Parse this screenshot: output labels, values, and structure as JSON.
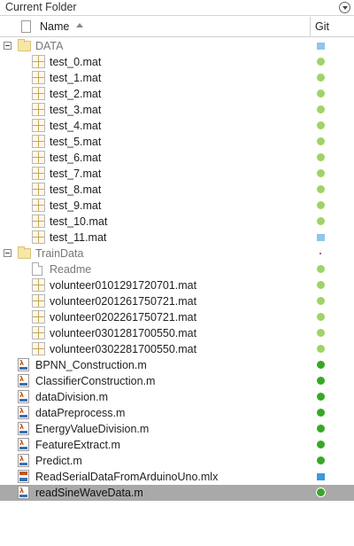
{
  "panel": {
    "title": "Current Folder"
  },
  "columns": {
    "name": "Name",
    "git": "Git"
  },
  "rows": [
    {
      "label": "DATA",
      "type": "folder",
      "indent": 0,
      "expandable": true,
      "git": "square"
    },
    {
      "label": "test_0.mat",
      "type": "mat",
      "indent": 1,
      "git": "unmodified"
    },
    {
      "label": "test_1.mat",
      "type": "mat",
      "indent": 1,
      "git": "unmodified"
    },
    {
      "label": "test_2.mat",
      "type": "mat",
      "indent": 1,
      "git": "unmodified"
    },
    {
      "label": "test_3.mat",
      "type": "mat",
      "indent": 1,
      "git": "unmodified"
    },
    {
      "label": "test_4.mat",
      "type": "mat",
      "indent": 1,
      "git": "unmodified"
    },
    {
      "label": "test_5.mat",
      "type": "mat",
      "indent": 1,
      "git": "unmodified"
    },
    {
      "label": "test_6.mat",
      "type": "mat",
      "indent": 1,
      "git": "unmodified"
    },
    {
      "label": "test_7.mat",
      "type": "mat",
      "indent": 1,
      "git": "unmodified"
    },
    {
      "label": "test_8.mat",
      "type": "mat",
      "indent": 1,
      "git": "unmodified"
    },
    {
      "label": "test_9.mat",
      "type": "mat",
      "indent": 1,
      "git": "unmodified"
    },
    {
      "label": "test_10.mat",
      "type": "mat",
      "indent": 1,
      "git": "unmodified"
    },
    {
      "label": "test_11.mat",
      "type": "mat",
      "indent": 1,
      "git": "square"
    },
    {
      "label": "TrainData",
      "type": "folder",
      "indent": 0,
      "expandable": true,
      "git": "tiny"
    },
    {
      "label": "Readme",
      "type": "doc",
      "indent": 1,
      "git": "unmodified"
    },
    {
      "label": "volunteer0101291720701.mat",
      "type": "mat",
      "indent": 1,
      "git": "unmodified"
    },
    {
      "label": "volunteer0201261750721.mat",
      "type": "mat",
      "indent": 1,
      "git": "unmodified"
    },
    {
      "label": "volunteer0202261750721.mat",
      "type": "mat",
      "indent": 1,
      "git": "unmodified"
    },
    {
      "label": "volunteer0301281700550.mat",
      "type": "mat",
      "indent": 1,
      "git": "unmodified"
    },
    {
      "label": "volunteer0302281700550.mat",
      "type": "mat",
      "indent": 1,
      "git": "unmodified"
    },
    {
      "label": "BPNN_Construction.m",
      "type": "m",
      "indent": 0,
      "git": "modified-dot"
    },
    {
      "label": "ClassifierConstruction.m",
      "type": "m",
      "indent": 0,
      "git": "modified-dot"
    },
    {
      "label": "dataDivision.m",
      "type": "m",
      "indent": 0,
      "git": "modified-dot"
    },
    {
      "label": "dataPreprocess.m",
      "type": "m",
      "indent": 0,
      "git": "modified-dot"
    },
    {
      "label": "EnergyValueDivision.m",
      "type": "m",
      "indent": 0,
      "git": "modified-dot"
    },
    {
      "label": "FeatureExtract.m",
      "type": "m",
      "indent": 0,
      "git": "modified-dot"
    },
    {
      "label": "Predict.m",
      "type": "m",
      "indent": 0,
      "git": "modified-dot"
    },
    {
      "label": "ReadSerialDataFromArduinoUno.mlx",
      "type": "mlx",
      "indent": 0,
      "git": "square-strong"
    },
    {
      "label": "readSineWaveData.m",
      "type": "m",
      "indent": 0,
      "git": "ring",
      "selected": true
    }
  ]
}
